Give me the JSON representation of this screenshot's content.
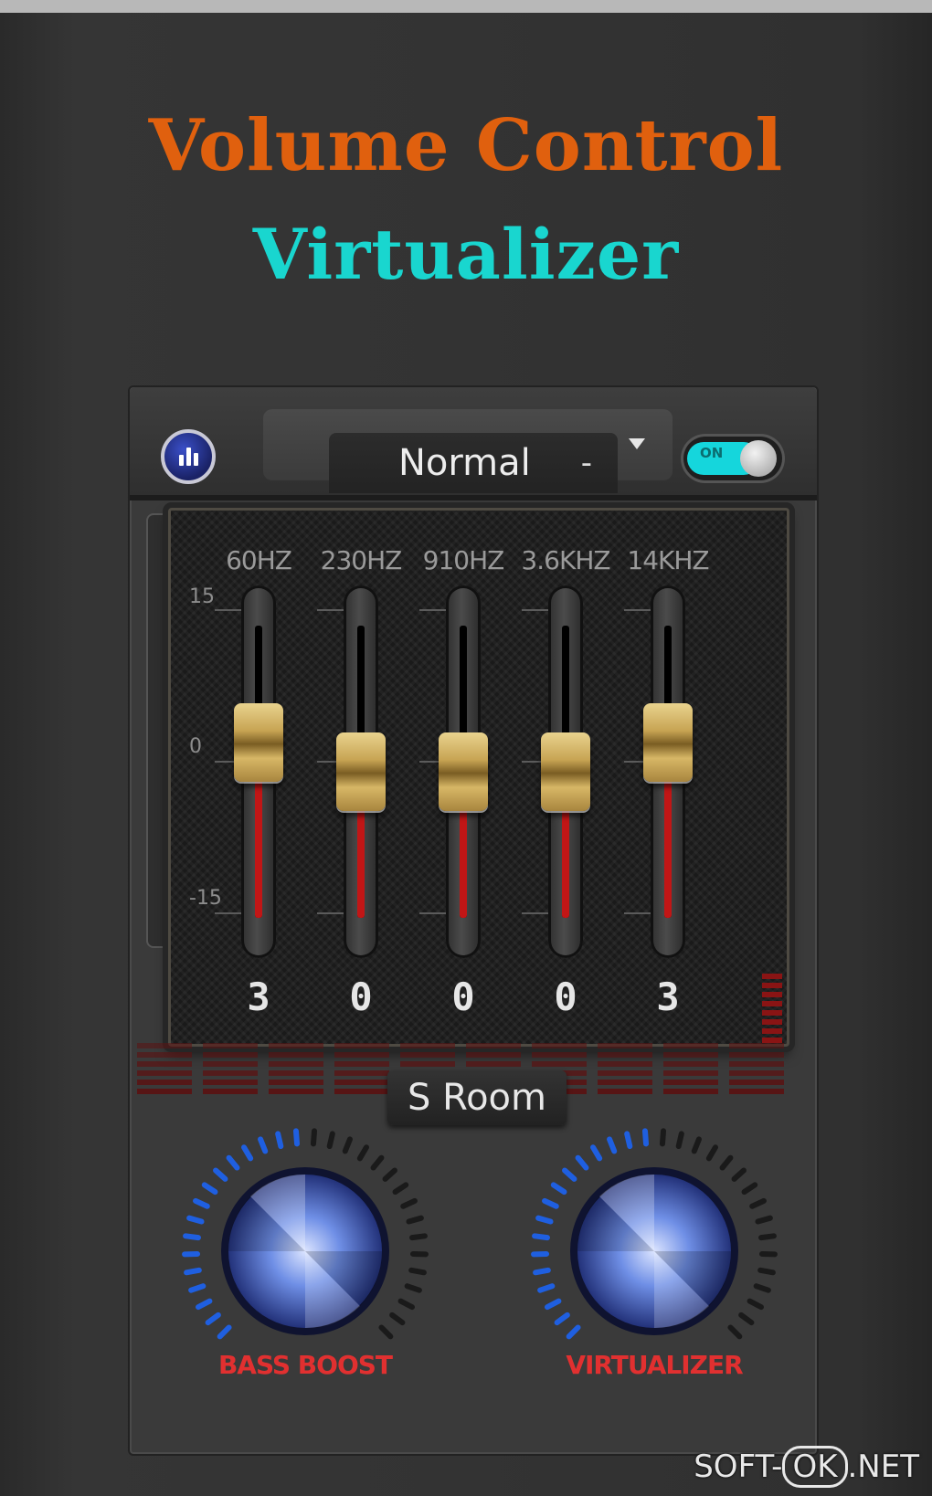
{
  "header": {
    "title_line1": "Volume Control",
    "title_line2": "Virtualizer",
    "title_line1_color": "#e0600e",
    "title_line2_color": "#19d6cf"
  },
  "toolbar": {
    "equalizer_icon": "equalizer-bars-icon",
    "preset_value": "Normal",
    "preset_dash": "-",
    "toggle_label": "ON",
    "toggle_on": true,
    "toggle_color": "#15d6dc"
  },
  "equalizer": {
    "scale": {
      "top": "15",
      "mid": "0",
      "bottom": "-15"
    },
    "bands": [
      {
        "freq": "60HZ",
        "value": "3"
      },
      {
        "freq": "230HZ",
        "value": "0"
      },
      {
        "freq": "910HZ",
        "value": "0"
      },
      {
        "freq": "3.6KHZ",
        "value": "0"
      },
      {
        "freq": "14KHZ",
        "value": "3"
      }
    ],
    "fill_color": "#c11616"
  },
  "room_button": {
    "label": "S Room"
  },
  "knobs": [
    {
      "label": "BASS BOOST",
      "level": 0.5
    },
    {
      "label": "VIRTUALIZER",
      "level": 0.5
    }
  ],
  "knob_accent": "#1f5fe0",
  "knob_label_color": "#e13030",
  "watermark": {
    "left": "SOFT-",
    "mid": "OK",
    "right": ".NET"
  }
}
